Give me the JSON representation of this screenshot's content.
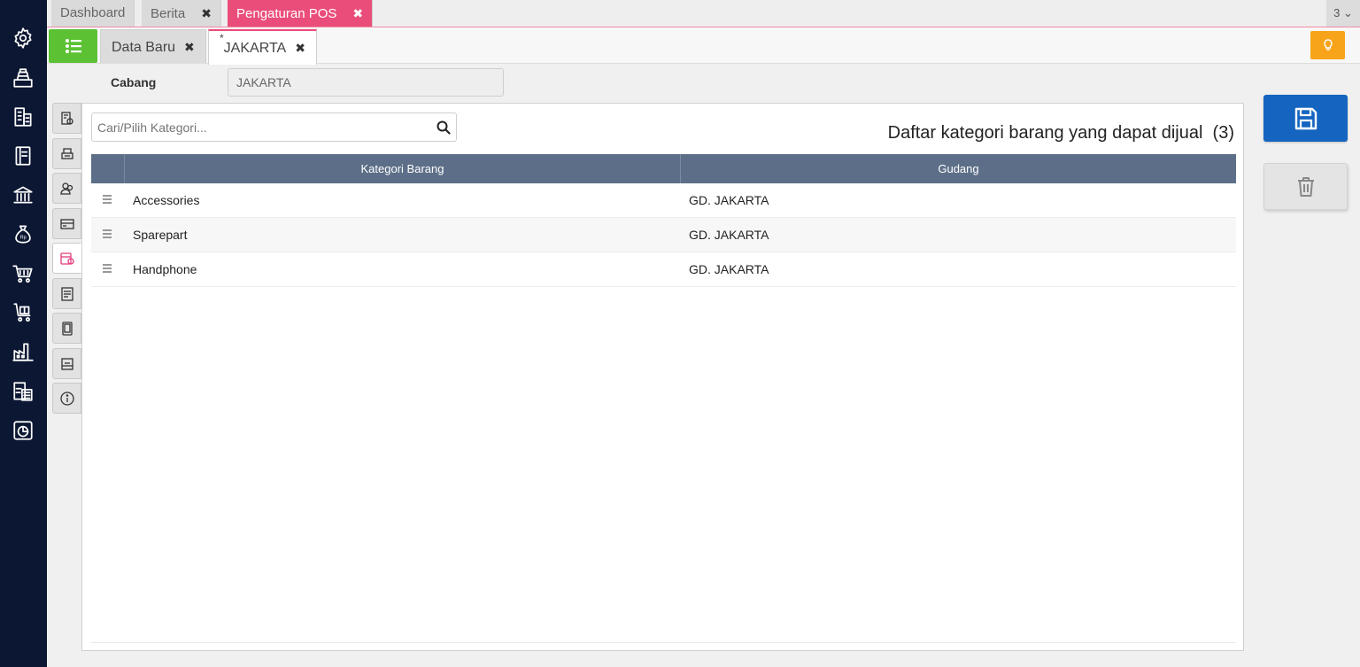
{
  "app": {
    "colors": {
      "sidebar": "#0c1733",
      "accent_pink": "#ea4d79",
      "menu_green": "#5cc234",
      "save_blue": "#1565c0",
      "bulb_orange": "#f7a41a",
      "table_header": "#5d6f88"
    }
  },
  "sidebar": {
    "icons": [
      "gear-icon",
      "cashier-icon",
      "building-icon",
      "ledger-icon",
      "bank-icon",
      "money-bag-icon",
      "cart-icon",
      "cart-box-icon",
      "factory-icon",
      "tax-document-icon",
      "report-chart-icon"
    ]
  },
  "top_tabs": [
    {
      "label": "Dashboard",
      "closable": false
    },
    {
      "label": "Berita",
      "closable": true,
      "close": "✖"
    },
    {
      "label": "Pengaturan POS",
      "closable": true,
      "close": "✖",
      "active": true
    }
  ],
  "tab_count": "3",
  "sub_tabs": [
    {
      "label": "Data Baru",
      "close": "✖"
    },
    {
      "label": "JAKARTA",
      "modified_mark": "*",
      "close": "✖",
      "active": true
    }
  ],
  "form": {
    "cabang_label": "Cabang",
    "cabang_value": "JAKARTA"
  },
  "vertical_tabs": [
    "pos-settings-icon",
    "printer-icon",
    "users-icon",
    "payment-icon",
    "category-icon",
    "receipt-icon",
    "device-icon",
    "display-icon",
    "info-icon"
  ],
  "panel": {
    "search_placeholder": "Cari/Pilih Kategori...",
    "title": "Daftar kategori barang yang dapat dijual",
    "count": "(3)",
    "columns": [
      "Kategori Barang",
      "Gudang"
    ],
    "rows": [
      {
        "kategori": "Accessories",
        "gudang": "GD. JAKARTA"
      },
      {
        "kategori": "Sparepart",
        "gudang": "GD. JAKARTA"
      },
      {
        "kategori": "Handphone",
        "gudang": "GD. JAKARTA"
      }
    ]
  }
}
